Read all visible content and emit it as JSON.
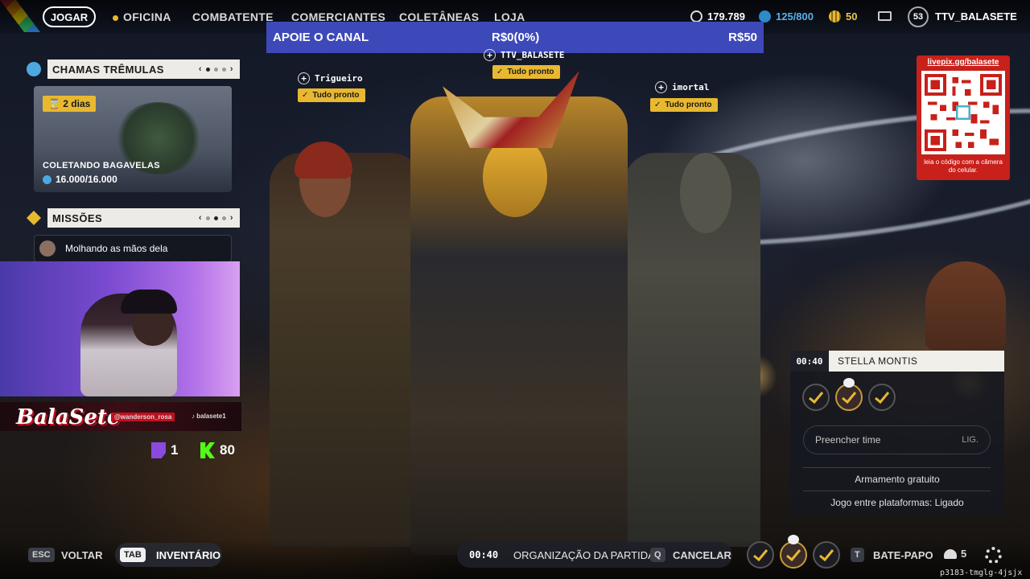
{
  "nav": {
    "play": "JOGAR",
    "items": [
      "OFICINA",
      "COMBATENTE",
      "COMERCIANTES",
      "COLETÂNEAS",
      "LOJA"
    ],
    "currency_1": "179.789",
    "currency_2": "125/800",
    "currency_3": "50",
    "level": "53",
    "username": "TTV_BALASETE"
  },
  "donation": {
    "label": "APOIE O CANAL",
    "current": "R$0(0%)",
    "goal": "R$50"
  },
  "event_panel": {
    "title": "CHAMAS TRÊMULAS",
    "badge": "2 dias",
    "task": "COLETANDO BAGAVELAS",
    "progress": "16.000/16.000"
  },
  "missions_panel": {
    "title": "MISSÕES",
    "item": "Molhando as mãos dela"
  },
  "stream_overlay": {
    "brand": "BalaSete",
    "instagram": "@wanderson_rosa",
    "tiktok": "balasete1",
    "twitch_count": "1",
    "kick_count": "80"
  },
  "players": [
    {
      "name": "Trigueiro",
      "status": "Tudo pronto"
    },
    {
      "name": "TTV_BALASETE",
      "status": "Tudo pronto"
    },
    {
      "name": "imortal",
      "status": "Tudo pronto"
    }
  ],
  "qr": {
    "title": "livepix.gg/balasete",
    "caption": "leia o código com a câmera do celular."
  },
  "lobby": {
    "timer": "00:40",
    "map": "STELLA MONTIS",
    "fill_team": "Preencher time",
    "fill_state": "LIG.",
    "option_1": "Armamento gratuito",
    "option_2": "Jogo entre plataformas: Ligado"
  },
  "bottom": {
    "esc_key": "ESC",
    "back": "VOLTAR",
    "tab_key": "TAB",
    "inventory": "INVENTÁRIO",
    "timer": "00:40",
    "matchmaking": "ORGANIZAÇÃO DA PARTIDA",
    "q_key": "Q",
    "cancel": "CANCELAR",
    "t_key": "T",
    "chat": "BATE-PAPO",
    "party_count": "5",
    "lobby_code": "p3183-tmglg-4jsjx"
  },
  "colors": {
    "accent_gold": "#e8b830",
    "donation_blue": "#3e49b9",
    "qr_red": "#c8201a"
  }
}
